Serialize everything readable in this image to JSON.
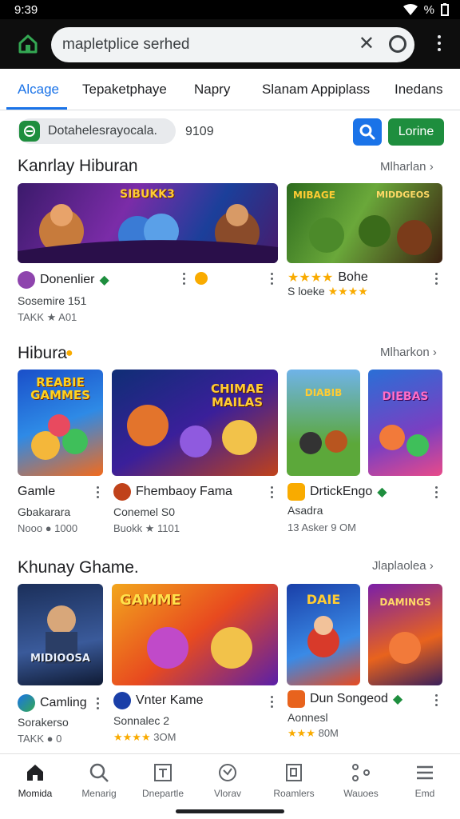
{
  "status": {
    "time": "9:39",
    "battery_label": "%"
  },
  "browser": {
    "url_text": "mapletplice serhed"
  },
  "tabs": [
    {
      "label": "Alcage"
    },
    {
      "label": "Tepaketphaye"
    },
    {
      "label": "Napry"
    },
    {
      "label": "Slanam Appiplass"
    },
    {
      "label": "Inedans"
    }
  ],
  "filter": {
    "chip_label": "Dotahelesrayocala.",
    "count": "9109",
    "login_label": "Lorine"
  },
  "sections": [
    {
      "title": "Kanrlay Hiburan",
      "more": "Mlharlan",
      "items": [
        {
          "title": "Donenlier",
          "sub": "Sosemire 151",
          "stat": "TAKK ★ A01",
          "art_text": "SIBUKK3"
        },
        {
          "title": "Bohe",
          "sub": "S loeke",
          "stat": "",
          "art_text": "MIBAGE",
          "art_text2": "MIDDGEOS"
        }
      ]
    },
    {
      "title": "Hibura",
      "more": "Mlharkon",
      "items": [
        {
          "title": "Gamle",
          "sub": "Gbakarara",
          "stat": "Nooo ● 1000",
          "art_text": "REABIE GAMMES"
        },
        {
          "title": "Fhembaoy Fama",
          "sub": "Conemel S0",
          "stat": "Buokk ★ 1101",
          "art_text": "CHIMAE MAILAS"
        },
        {
          "title": "DrtickEngo",
          "sub": "Asadra",
          "stat": "13 Asker 9 OM",
          "art_text": "DIABIB"
        },
        {
          "title": "",
          "sub": "",
          "stat": "",
          "art_text": "DIEBAS"
        }
      ]
    },
    {
      "title": "Khunay Ghame.",
      "more": "Jlaplaolea",
      "items": [
        {
          "title": "Camling",
          "sub": "Sorakerso",
          "stat": "TAKK ● 0",
          "art_text": "MIDIOOSA"
        },
        {
          "title": "Vnter Kame",
          "sub": "Sonnalec 2",
          "stat": "3OM",
          "art_text": "GAMME"
        },
        {
          "title": "Dun Songeod",
          "sub": "Aonnesl",
          "stat": "80M",
          "art_text": "DAIE"
        },
        {
          "title": "",
          "sub": "",
          "stat": "",
          "art_text": "DAMINGS"
        }
      ]
    }
  ],
  "bottom_nav": [
    {
      "label": "Momida"
    },
    {
      "label": "Menarig"
    },
    {
      "label": "Dnepartle"
    },
    {
      "label": "Vlorav"
    },
    {
      "label": "Roamlers"
    },
    {
      "label": "Wauoes"
    },
    {
      "label": "Emd"
    }
  ],
  "colors": {
    "accent_blue": "#1a73e8",
    "accent_green": "#1e8e3e",
    "appbar": "#0e0e0e",
    "star": "#f9ab00"
  }
}
